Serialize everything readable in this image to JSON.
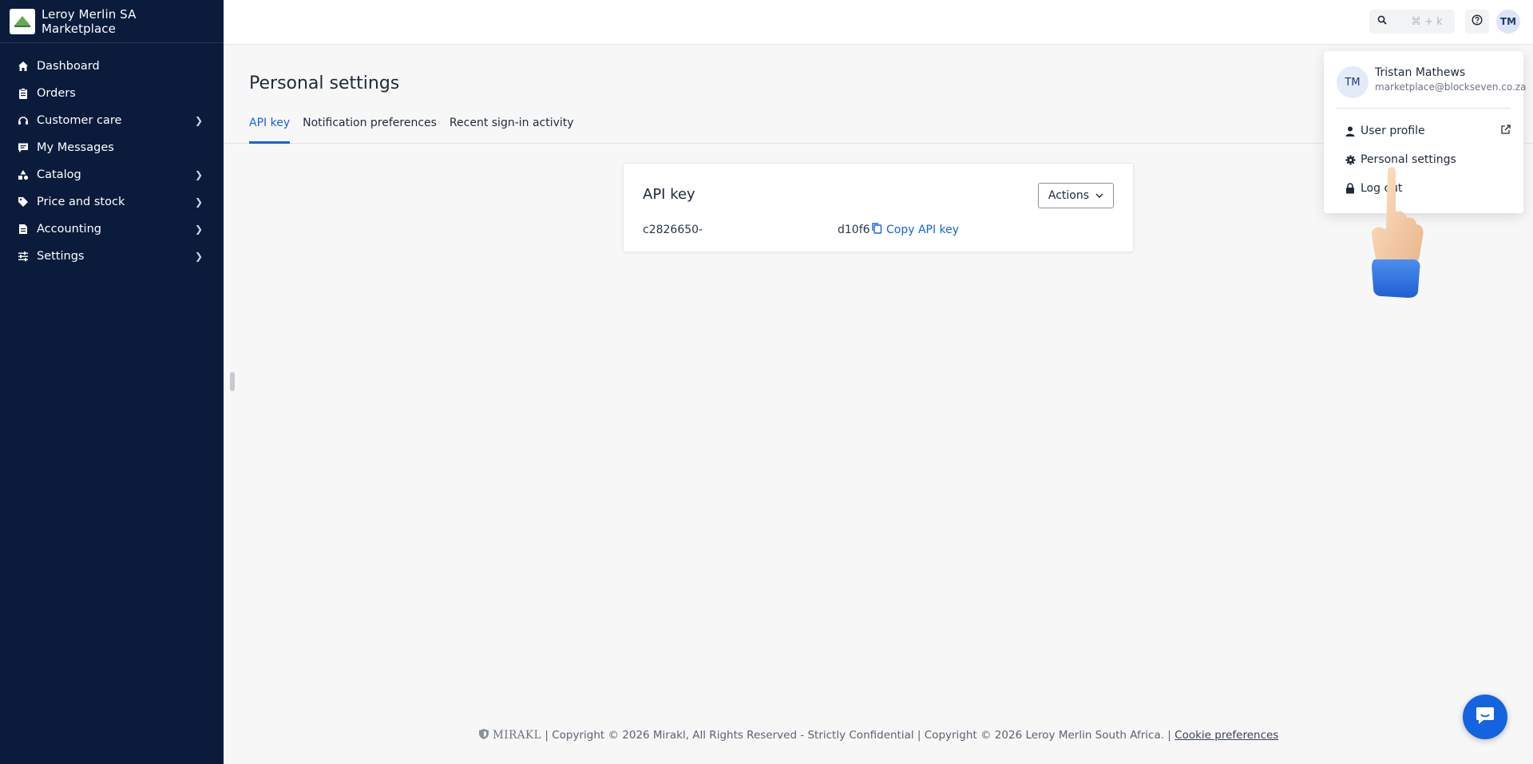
{
  "sidebar": {
    "brand_name": "Leroy Merlin SA Marketplace",
    "items": [
      {
        "label": "Dashboard",
        "icon": "home-icon",
        "has_children": false
      },
      {
        "label": "Orders",
        "icon": "clipboard-icon",
        "has_children": false
      },
      {
        "label": "Customer care",
        "icon": "headset-icon",
        "has_children": true
      },
      {
        "label": "My Messages",
        "icon": "message-icon",
        "has_children": false
      },
      {
        "label": "Catalog",
        "icon": "shapes-icon",
        "has_children": true
      },
      {
        "label": "Price and stock",
        "icon": "tag-icon",
        "has_children": true
      },
      {
        "label": "Accounting",
        "icon": "invoice-icon",
        "has_children": true
      },
      {
        "label": "Settings",
        "icon": "sliders-icon",
        "has_children": true
      }
    ]
  },
  "topbar": {
    "search_shortcut": "⌘ + k",
    "avatar_initials": "TM"
  },
  "main": {
    "title": "Personal settings",
    "tabs": [
      {
        "label": "API key",
        "active": true
      },
      {
        "label": "Notification preferences",
        "active": false
      },
      {
        "label": "Recent sign-in activity",
        "active": false
      }
    ],
    "card": {
      "title": "API key",
      "actions_label": "Actions",
      "key_start": "c2826650-",
      "key_end": "d10f6",
      "copy_label": "Copy API key"
    }
  },
  "footer": {
    "logo_text": "MIRAKL",
    "text": "| Copyright © 2026 Mirakl, All Rights Reserved - Strictly Confidential | Copyright © 2026 Leroy Merlin South Africa.  |",
    "cookie_label": "Cookie preferences"
  },
  "user_menu": {
    "initials": "TM",
    "name": "Tristan Mathews",
    "email": "marketplace@blockseven.co.za",
    "items": {
      "profile": "User profile",
      "settings": "Personal settings",
      "logout": "Log out"
    }
  },
  "colors": {
    "sidebar_bg": "#0b1b3b",
    "accent": "#1463e0"
  }
}
